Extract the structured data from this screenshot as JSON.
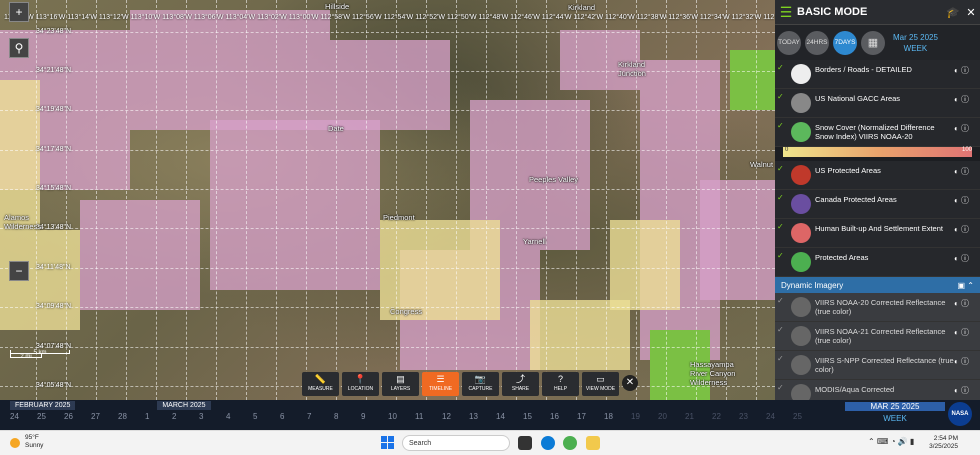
{
  "map": {
    "top_coordinates": "113°18'W 113°16'W 113°14'W 113°12'W 113°10'W 113°08'W 113°06'W 113°04'W 113°02'W 113°00'W 112°58'W 112°56'W 112°54'W 112°52'W 112°50'W 112°48'W 112°46'W 112°44'W 112°42'W 112°40'W 112°38'W 112°36'W 112°34'W 112°32'W 112°30'W",
    "lat_labels": [
      "34°23'48\"N",
      "34°21'48\"N",
      "34°19'48\"N",
      "34°17'48\"N",
      "34°15'48\"N",
      "34°13'48\"N",
      "34°11'48\"N",
      "34°09'48\"N",
      "34°07'48\"N",
      "34°05'48\"N"
    ],
    "places": {
      "hillside": "Hillside",
      "kirkland": "Kirkland",
      "kirkland_junction": "Kirkland Junction",
      "date": "Date",
      "peeples_valley": "Peeples Valley",
      "piedmont": "Piedmont",
      "yarnell": "Yarnell",
      "congress": "Congress",
      "alamos": "Alamos Wilderness",
      "walnut": "Walnut",
      "hassayampa": "Hassayampa River Canyon Wilderness"
    },
    "scale_km": "5 km",
    "scale_mi": "2 mi",
    "zoom_in": "+",
    "zoom_out": "−"
  },
  "panel": {
    "title": "BASIC MODE",
    "buttons": {
      "today": "TODAY",
      "hrs24": "24HRS",
      "days7": "7DAYS"
    },
    "date": "Mar 25 2025",
    "interval": "WEEK",
    "layers": [
      {
        "name": "Borders / Roads - DETAILED"
      },
      {
        "name": "US National GACC Areas"
      },
      {
        "name": "Snow Cover (Normalized Difference Snow Index) VIIRS NOAA-20",
        "ramp_max": "100",
        "ramp_min": "0"
      },
      {
        "name": "US Protected Areas"
      },
      {
        "name": "Canada Protected Areas"
      },
      {
        "name": "Human Built-up And Settlement Extent"
      },
      {
        "name": "Protected Areas"
      }
    ],
    "section": "Dynamic Imagery",
    "dynamic_layers": [
      {
        "name": "VIIRS NOAA-20 Corrected Reflectance (true color)"
      },
      {
        "name": "VIIRS NOAA-21 Corrected Reflectance (true color)"
      },
      {
        "name": "VIIRS S-NPP Corrected Reflectance (true color)"
      },
      {
        "name": "MODIS/Aqua Corrected"
      }
    ]
  },
  "toolbar": [
    {
      "label": "MEASURE",
      "icon": "ruler-icon",
      "glyph": "📏"
    },
    {
      "label": "LOCATION",
      "icon": "location-pin-icon",
      "glyph": "📍"
    },
    {
      "label": "LAYERS",
      "icon": "layers-icon",
      "glyph": "▤"
    },
    {
      "label": "TIMELINE",
      "icon": "timeline-icon",
      "glyph": "☰"
    },
    {
      "label": "CAPTURE",
      "icon": "camera-icon",
      "glyph": "📷"
    },
    {
      "label": "SHARE",
      "icon": "share-icon",
      "glyph": "⤴"
    },
    {
      "label": "HELP",
      "icon": "help-icon",
      "glyph": "?"
    },
    {
      "label": "VIEW MODE",
      "icon": "monitor-icon",
      "glyph": "▭"
    }
  ],
  "timeline": {
    "month1": "FEBRUARY 2025",
    "month2": "MARCH 2025",
    "days": [
      "24",
      "25",
      "26",
      "27",
      "28",
      "1",
      "2",
      "3",
      "4",
      "5",
      "6",
      "7",
      "8",
      "9",
      "10",
      "11",
      "12",
      "13",
      "14",
      "15",
      "16",
      "17",
      "18",
      "19",
      "20",
      "21",
      "22",
      "23",
      "24",
      "25"
    ],
    "selected_date": "MAR 25 2025",
    "selected_interval": "WEEK",
    "logo": "NASA"
  },
  "taskbar": {
    "temp": "95°F",
    "condition": "Sunny",
    "search": "Search",
    "time": "2:54 PM",
    "date": "3/25/2025"
  }
}
